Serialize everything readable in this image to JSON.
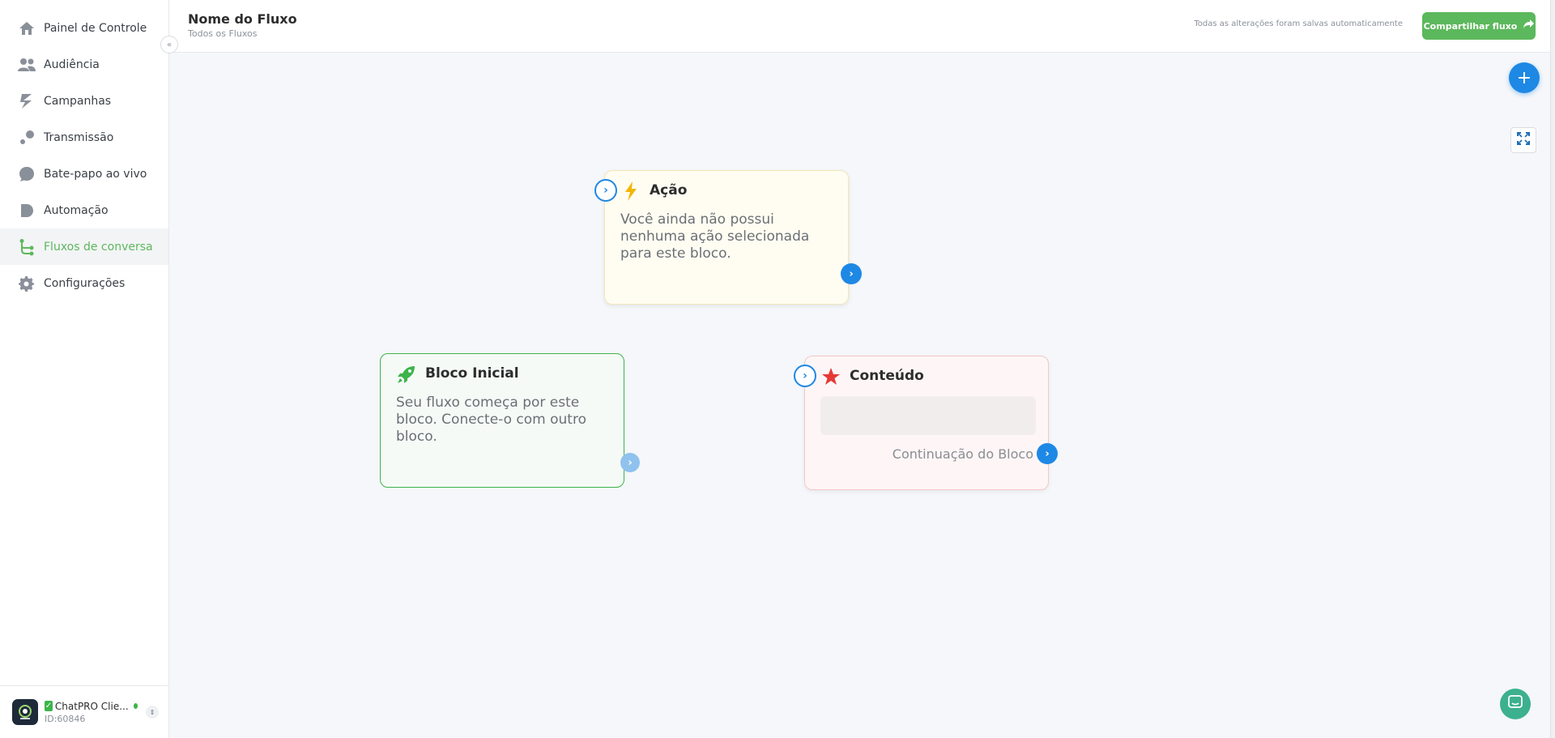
{
  "sidebar": {
    "items": [
      {
        "label": "Painel de Controle",
        "icon": "home-icon"
      },
      {
        "label": "Audiência",
        "icon": "users-icon"
      },
      {
        "label": "Campanhas",
        "icon": "campaigns-icon"
      },
      {
        "label": "Transmissão",
        "icon": "broadcast-icon"
      },
      {
        "label": "Bate-papo ao vivo",
        "icon": "chat-bubble-icon"
      },
      {
        "label": "Automação",
        "icon": "automation-icon"
      },
      {
        "label": "Fluxos de conversa",
        "icon": "flow-icon"
      },
      {
        "label": "Configurações",
        "icon": "gear-icon"
      }
    ],
    "active_index": 6,
    "collapse_label": "«",
    "account": {
      "name": "ChatPRO Clie...",
      "id": "ID:60846"
    }
  },
  "header": {
    "title": "Nome do Fluxo",
    "subtitle": "Todos os Fluxos",
    "saved_status": "Todas as alterações foram salvas automaticamente",
    "share_label": "Compartilhar fluxo"
  },
  "canvas": {
    "add_label": "+",
    "blocks": {
      "start": {
        "title": "Bloco Inicial",
        "description": "Seu fluxo começa por este bloco. Conecte-o com outro bloco."
      },
      "action": {
        "title": "Ação",
        "description": "Você ainda não possui nenhuma ação selecionada para este bloco."
      },
      "content": {
        "title": "Conteúdo",
        "continuation": "Continuação do Bloco"
      }
    }
  },
  "colors": {
    "accent_green": "#5cb85c",
    "accent_blue": "#1e88e5",
    "start_border": "#3db34c",
    "action_bg": "#fffdf2",
    "content_bg": "#fef6f6"
  }
}
